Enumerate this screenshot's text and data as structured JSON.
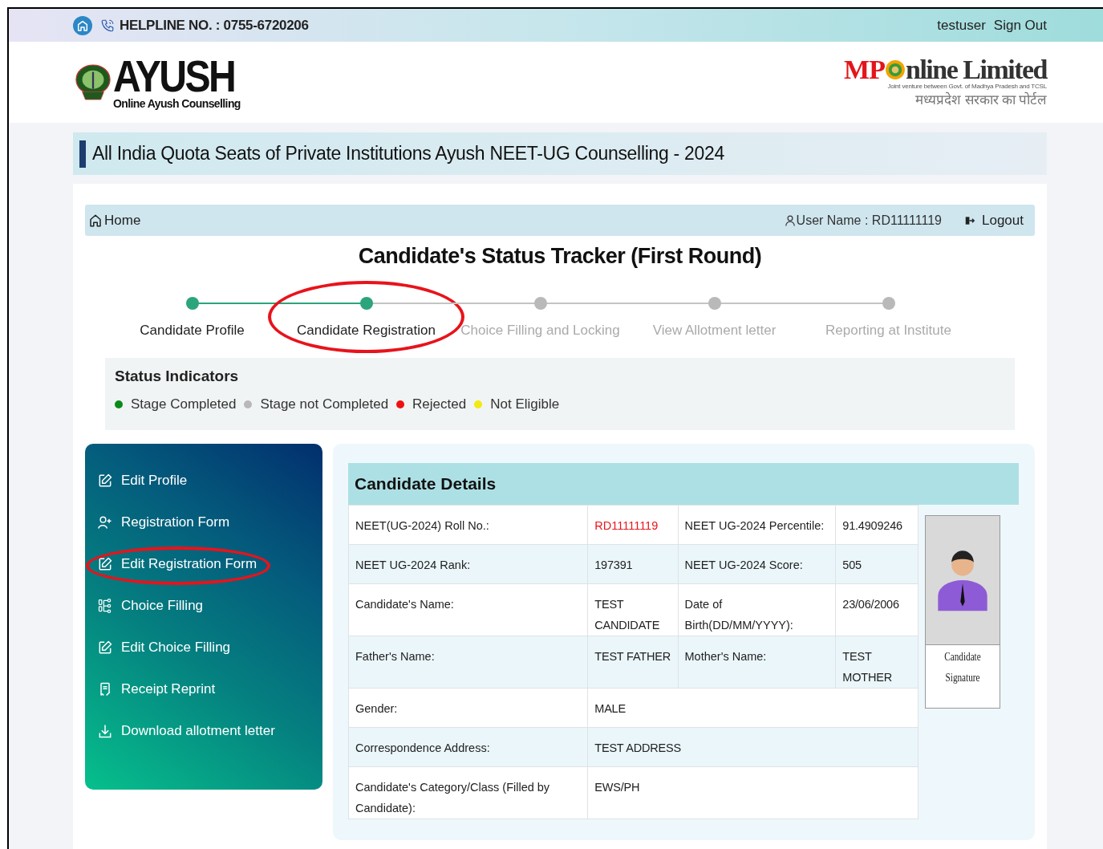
{
  "top_bar": {
    "helpline": "HELPLINE NO. : 0755-6720206",
    "user": "testuser",
    "sign_out": "Sign Out"
  },
  "header": {
    "logo_title": "AYUSH",
    "logo_subtitle": "Online Ayush Counselling",
    "partner_logo": {
      "red_part": "MP",
      "dark_part": "nline Limited",
      "tagline": "Joint venture between Govt. of Madhya Pradesh and TCSL",
      "hindi": "मध्यप्रदेश सरकार का पोर्टल"
    }
  },
  "page_title": "All India Quota Seats of Private Institutions Ayush NEET-UG Counselling - 2024",
  "nav": {
    "home": "Home",
    "user_name": "User Name : RD11111119",
    "logout": "Logout"
  },
  "tracker": {
    "title": "Candidate's Status Tracker (First Round)",
    "steps": [
      {
        "label": "Candidate Profile",
        "completed": true,
        "circled": false
      },
      {
        "label": "Candidate Registration",
        "completed": true,
        "circled": true
      },
      {
        "label": "Choice Filling and Locking",
        "completed": false,
        "circled": false
      },
      {
        "label": "View Allotment letter",
        "completed": false,
        "circled": false
      },
      {
        "label": "Reporting at Institute",
        "completed": false,
        "circled": false
      }
    ]
  },
  "status_indicators": {
    "title": "Status Indicators",
    "items": [
      {
        "label": "Stage Completed",
        "color": "#0a8a1a"
      },
      {
        "label": "Stage not Completed",
        "color": "#b8b8b8"
      },
      {
        "label": "Rejected",
        "color": "#ee1111"
      },
      {
        "label": "Not Eligible",
        "color": "#f2ea10"
      }
    ]
  },
  "sidebar": {
    "items": [
      {
        "label": "Edit Profile",
        "circled": false
      },
      {
        "label": "Registration Form",
        "circled": false
      },
      {
        "label": "Edit Registration Form",
        "circled": true
      },
      {
        "label": "Choice Filling",
        "circled": false
      },
      {
        "label": "Edit Choice Filling",
        "circled": false
      },
      {
        "label": "Receipt Reprint",
        "circled": false
      },
      {
        "label": "Download allotment letter",
        "circled": false
      }
    ]
  },
  "details": {
    "title": "Candidate Details",
    "signature_label": "Candidate Signature",
    "rows": [
      {
        "cells": [
          {
            "text": "NEET(UG-2024) Roll No.:",
            "kind": "label"
          },
          {
            "text": "RD11111119",
            "kind": "alert"
          },
          {
            "text": "NEET UG-2024 Percentile:",
            "kind": "label"
          },
          {
            "text": "91.4909246",
            "kind": "value"
          }
        ]
      },
      {
        "cells": [
          {
            "text": "NEET UG-2024 Rank:",
            "kind": "label"
          },
          {
            "text": "197391",
            "kind": "value"
          },
          {
            "text": "NEET UG-2024 Score:",
            "kind": "label"
          },
          {
            "text": "505",
            "kind": "value"
          }
        ]
      },
      {
        "cells": [
          {
            "text": "Candidate's Name:",
            "kind": "label"
          },
          {
            "text": "TEST CANDIDATE",
            "kind": "value"
          },
          {
            "text": "Date of Birth(DD/MM/YYYY):",
            "kind": "label"
          },
          {
            "text": "23/06/2006",
            "kind": "value"
          }
        ]
      },
      {
        "cells": [
          {
            "text": "Father's Name:",
            "kind": "label"
          },
          {
            "text": "TEST FATHER",
            "kind": "value"
          },
          {
            "text": "Mother's Name:",
            "kind": "label"
          },
          {
            "text": "TEST MOTHER",
            "kind": "value"
          }
        ]
      },
      {
        "cells": [
          {
            "text": "Gender:",
            "kind": "label"
          },
          {
            "text": "MALE",
            "kind": "value",
            "colspan": 3
          }
        ]
      },
      {
        "cells": [
          {
            "text": "Correspondence Address:",
            "kind": "label"
          },
          {
            "text": "TEST ADDRESS",
            "kind": "value",
            "colspan": 3
          }
        ]
      },
      {
        "cells": [
          {
            "text": "Candidate's Category/Class (Filled by Candidate):",
            "kind": "label"
          },
          {
            "text": "EWS/PH",
            "kind": "value",
            "colspan": 3
          }
        ]
      }
    ]
  }
}
